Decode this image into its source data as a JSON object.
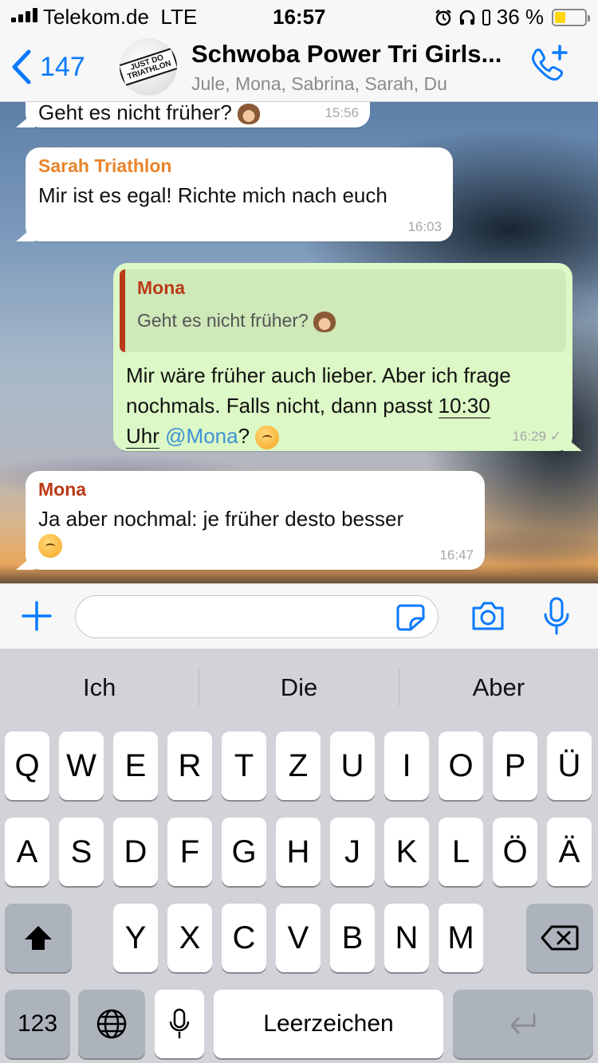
{
  "status_bar": {
    "carrier": "Telekom.de",
    "network": "LTE",
    "time": "16:57",
    "battery_percent": "36 %",
    "battery_level": 0.36
  },
  "header": {
    "back_count": "147",
    "group_name": "Schwoba Power Tri Girls...",
    "members": "Jule, Mona, Sabrina, Sarah, Du",
    "avatar_text": "JUST DO TRIATHLON"
  },
  "messages": [
    {
      "text": "Geht es nicht früher?",
      "time": "15:56"
    },
    {
      "sender": "Sarah Triathlon",
      "sender_color": "#e8842b",
      "text": "Mir ist es egal! Richte mich nach euch",
      "time": "16:03"
    },
    {
      "quote_sender": "Mona",
      "quote_text": "Geht es nicht früher?",
      "text_line1": "Mir wäre früher auch lieber. Aber ich frage",
      "text_line2_pre": "nochmals. Falls nicht, dann passt ",
      "text_link1": "10:30",
      "text_link2": "Uhr",
      "mention": "@Mona",
      "text_end": "?",
      "time": "16:29",
      "status": "✓"
    },
    {
      "sender": "Mona",
      "sender_color": "#b93a16",
      "text": "Ja aber nochmal: je früher desto besser",
      "time": "16:47"
    }
  ],
  "input": {
    "placeholder": ""
  },
  "keyboard": {
    "suggestions": [
      "Ich",
      "Die",
      "Aber"
    ],
    "row1": [
      "Q",
      "W",
      "E",
      "R",
      "T",
      "Z",
      "U",
      "I",
      "O",
      "P",
      "Ü"
    ],
    "row2": [
      "A",
      "S",
      "D",
      "F",
      "G",
      "H",
      "J",
      "K",
      "L",
      "Ö",
      "Ä"
    ],
    "row3": [
      "Y",
      "X",
      "C",
      "V",
      "B",
      "N",
      "M"
    ],
    "numbers_key": "123",
    "space_key": "Leerzeichen"
  },
  "colors": {
    "accent": "#0a7aff",
    "outgoing_bubble": "#dcf8c6",
    "incoming_bubble": "#ffffff"
  }
}
